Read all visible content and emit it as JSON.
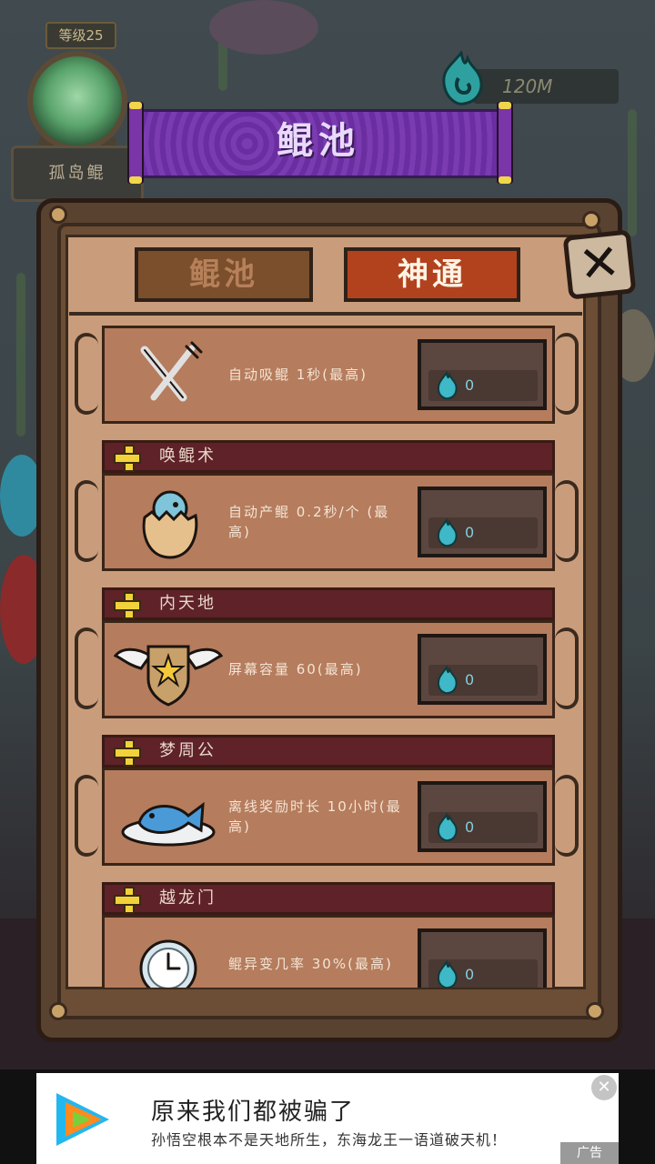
{
  "hud": {
    "level_label": "等级25",
    "name_plate": "孤岛鲲",
    "currency_value": "120M"
  },
  "banner": {
    "title": "鲲池"
  },
  "tabs": [
    {
      "label": "鲲池",
      "active": false
    },
    {
      "label": "神通",
      "active": true
    }
  ],
  "close_icon": "close-x-icon",
  "abilities": [
    {
      "name": "",
      "icon": "fork-knife-icon",
      "description": "自动吸鲲 1秒(最高)",
      "cost": "0"
    },
    {
      "name": "唤鲲术",
      "icon": "egg-bird-icon",
      "description": "自动产鲲 0.2秒/个 (最高)",
      "cost": "0"
    },
    {
      "name": "内天地",
      "icon": "winged-star-badge-icon",
      "description": "屏幕容量 60(最高)",
      "cost": "0"
    },
    {
      "name": "梦周公",
      "icon": "fish-plate-icon",
      "description": "离线奖励时长 10小时(最高)",
      "cost": "0"
    },
    {
      "name": "越龙门",
      "icon": "clock-icon",
      "description": "鲲异变几率 30%(最高)",
      "cost": "0"
    }
  ],
  "ad": {
    "title": "原来我们都被骗了",
    "subtitle": "孙悟空根本不是天地所生，东海龙王一语道破天机！",
    "tag": "广告",
    "close": "✕"
  },
  "colors": {
    "banner_purple": "#7a3cb0",
    "active_tab": "#b2421e",
    "inactive_tab": "#7b4e2c",
    "card": "#b57c5d",
    "header_bar": "#5e2228",
    "cost_text": "#7fd0e0"
  }
}
